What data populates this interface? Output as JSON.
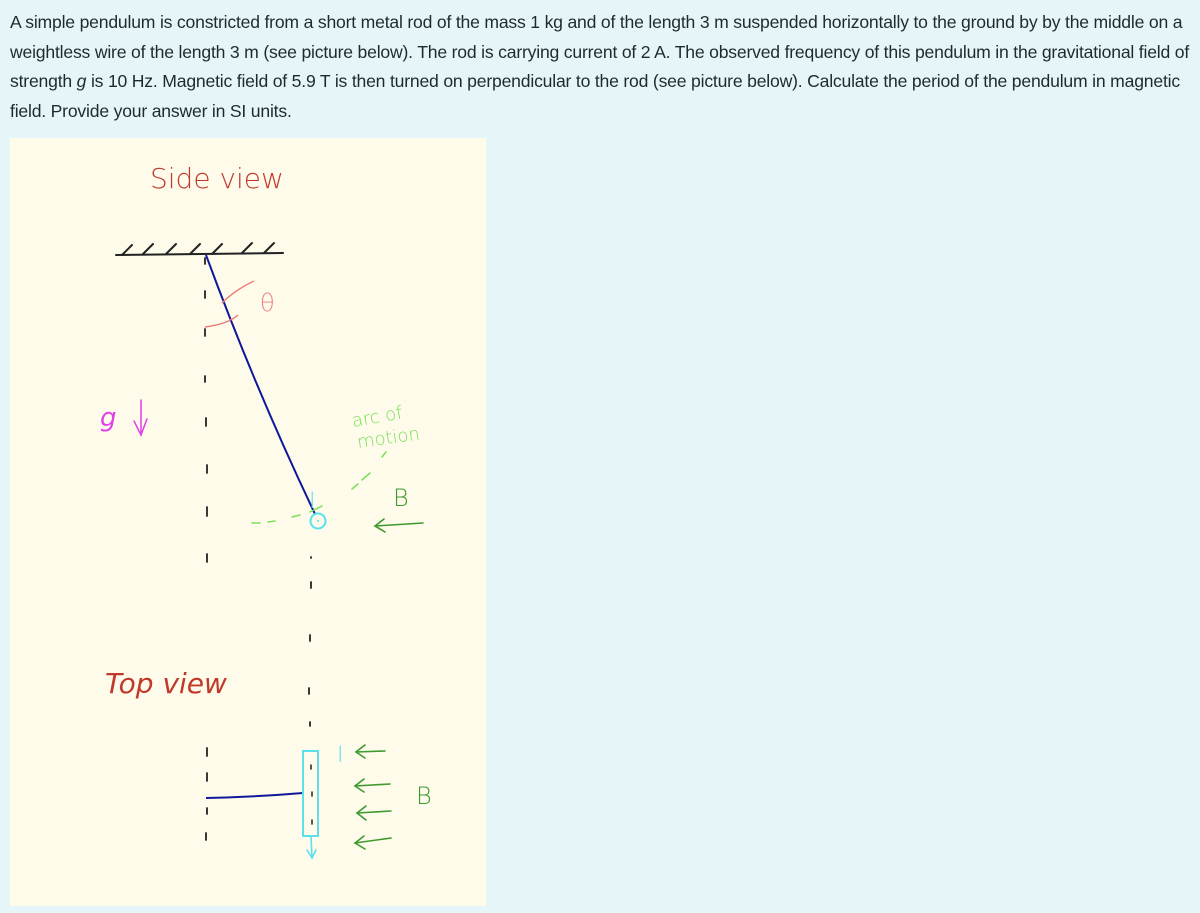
{
  "problem": {
    "text_before_g": "A simple pendulum is constricted from a short metal rod of the mass 1 kg and of the length 3 m suspended horizontally to the ground by by the middle on a weightless wire of the length 3 m (see picture below). The rod is carrying current of 2 A. The observed frequency of this pendulum in the gravitational field of strength ",
    "g_symbol": "g",
    "text_after_g": " is 10 Hz.  Magnetic field of 5.9 T is then turned on perpendicular to the rod (see picture below). Calculate the period of the pendulum in magnetic field. Provide your answer in SI units."
  },
  "figure": {
    "side_view_label": "Side view",
    "top_view_label": "Top view",
    "theta_label": "θ",
    "g_label": "g",
    "current_label": "I",
    "arc_label_line1": "arc of",
    "arc_label_line2": "motion",
    "field_label": "B",
    "colors": {
      "background": "#fefbeb",
      "title_red": "#c0392b",
      "wire_blue": "#10189a",
      "theta_pink": "#ee7a7a",
      "g_magenta": "#e040e8",
      "current_cyan": "#5ce0ee",
      "arc_green": "#7de05a",
      "field_green": "#3e9a2e",
      "ink_black": "#222222"
    }
  }
}
